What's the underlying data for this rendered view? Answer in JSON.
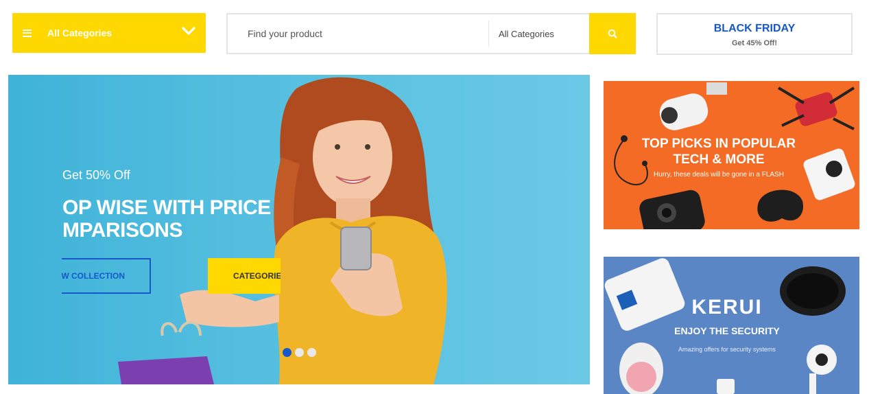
{
  "header": {
    "category_button": {
      "label": "All Categories",
      "icon": "menu-icon",
      "chevron": "chevron-down-icon"
    },
    "search": {
      "placeholder": "Find your product",
      "category_select": "All Categories",
      "button_icon": "search-icon"
    },
    "promo": {
      "title": "BLACK FRIDAY",
      "subtitle": "Get 45% Off!"
    }
  },
  "hero": {
    "offer": "Get 50% Off",
    "headline_line1": "OP WISE WITH PRICE",
    "headline_line2": "MPARISONS",
    "button_primary": "W COLLECTION",
    "button_secondary": "CATEGORIE",
    "slides": 3,
    "active_slide": 1
  },
  "banners": {
    "tech": {
      "title_line1": "TOP PICKS IN POPULAR",
      "title_line2": "TECH & MORE",
      "subtitle": "Hurry, these deals will be gone in a FLASH"
    },
    "security": {
      "brand": "KERUI",
      "title": "ENJOY THE SECURITY",
      "subtitle": "Amazing offers for security systems"
    }
  },
  "colors": {
    "accent_yellow": "#ffd800",
    "brand_blue": "#1658c9",
    "tech_orange": "#f36b24",
    "security_blue": "#5b86c6"
  }
}
